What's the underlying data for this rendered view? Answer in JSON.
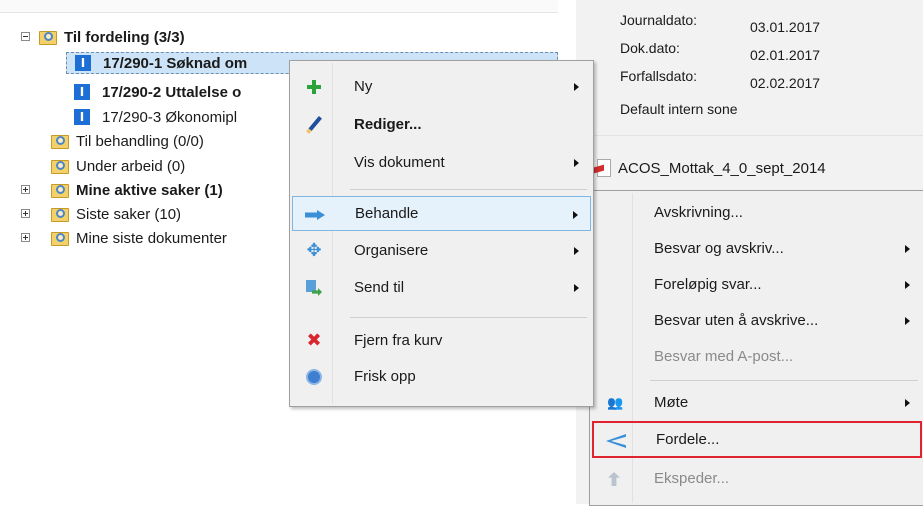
{
  "tree": {
    "items": [
      {
        "label": "Til fordeling (3/3)",
        "bold": true
      },
      {
        "label": "17/290-1 Søknad om",
        "bold": true,
        "type_letter": "I"
      },
      {
        "label": "17/290-2 Uttalelse o",
        "bold": true,
        "type_letter": "I"
      },
      {
        "label": "17/290-3 Økonomipl",
        "bold": false,
        "type_letter": "I"
      },
      {
        "label": "Til behandling (0/0)",
        "bold": false
      },
      {
        "label": "Under arbeid (0)",
        "bold": false
      },
      {
        "label": "Mine aktive saker (1)",
        "bold": true
      },
      {
        "label": "Siste saker (10)",
        "bold": false
      },
      {
        "label": "Mine siste dokumenter",
        "bold": false
      }
    ]
  },
  "details": {
    "journaldato_label": "Journaldato:",
    "journaldato_value": "03.01.2017",
    "dokdato_label": "Dok.dato:",
    "dokdato_value": "02.01.2017",
    "forfallsdato_label": "Forfallsdato:",
    "forfallsdato_value": "02.02.2017",
    "zone": "Default intern sone",
    "attachment": "ACOS_Mottak_4_0_sept_2014"
  },
  "context_menu": {
    "items": [
      {
        "label": "Ny",
        "icon": "plus-icon"
      },
      {
        "label": "Rediger...",
        "icon": "pencil-icon"
      },
      {
        "label": "Vis dokument"
      },
      {
        "label": "Behandle",
        "icon": "arrow-right-icon"
      },
      {
        "label": "Organisere",
        "icon": "move-icon"
      },
      {
        "label": "Send til",
        "icon": "send-icon"
      },
      {
        "label": "Fjern fra kurv",
        "icon": "remove-icon"
      },
      {
        "label": "Frisk opp",
        "icon": "refresh-icon"
      }
    ]
  },
  "submenu": {
    "items": [
      {
        "label": "Avskrivning..."
      },
      {
        "label": "Besvar og avskriv..."
      },
      {
        "label": "Foreløpig svar..."
      },
      {
        "label": "Besvar uten å avskrive..."
      },
      {
        "label": "Besvar med A-post..."
      },
      {
        "label": "Møte",
        "icon": "people-icon"
      },
      {
        "label": "Fordele...",
        "icon": "share-icon"
      },
      {
        "label": "Ekspeder...",
        "icon": "send-out-icon"
      }
    ]
  },
  "colors": {
    "selection": "#cde3f7",
    "highlight_border": "#e0232e",
    "menu_bg": "#f0f0f0"
  }
}
